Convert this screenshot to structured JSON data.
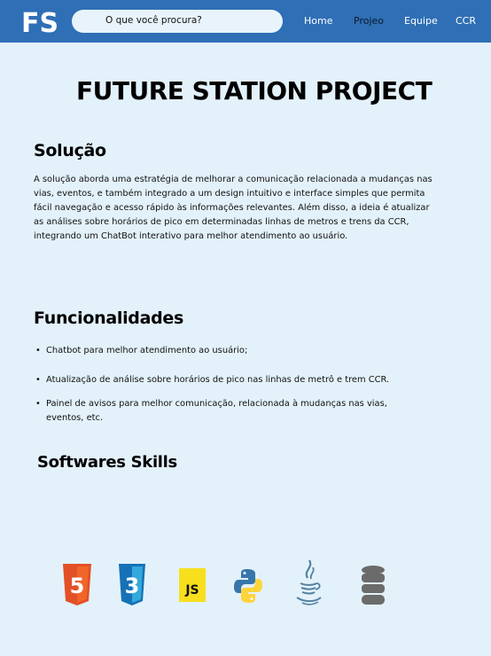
{
  "header": {
    "logo_text": "FS",
    "search_placeholder": "O que você procura?",
    "nav": [
      {
        "label": "Home",
        "active": false
      },
      {
        "label": "Projeo",
        "active": true
      },
      {
        "label": "Equipe",
        "active": false
      },
      {
        "label": "CCR",
        "active": false
      }
    ]
  },
  "page_title": "FUTURE STATION PROJECT",
  "solucao": {
    "heading": "Solução",
    "text": "A solução aborda uma estratégia de melhorar a comunicação relacionada a mudanças nas vias, eventos, e também integrado a um design intuitivo e interface simples que permita fácil navegação e acesso rápido às informações relevantes. Além disso, a ideia é atualizar as análises sobre horários de pico em determinadas linhas de metros e trens da CCR, integrando um ChatBot interativo para melhor atendimento ao usuário."
  },
  "funcionalidades": {
    "heading": "Funcionalidades",
    "items": [
      "Chatbot para melhor atendimento ao usuário;",
      "Atualização de análise sobre horários de pico nas linhas de metrô e trem CCR.",
      "Painel de avisos para melhor comunicação, relacionada à mudanças nas vias, eventos, etc."
    ]
  },
  "skills": {
    "heading": "Softwares Skills",
    "icons": [
      {
        "name": "html5-icon",
        "label": "5",
        "color": "#e34f26"
      },
      {
        "name": "css3-icon",
        "label": "3",
        "color": "#1572b6"
      },
      {
        "name": "javascript-icon",
        "label": "JS",
        "color": "#f7df1e"
      },
      {
        "name": "python-icon",
        "label": "",
        "color": "#3776ab"
      },
      {
        "name": "java-icon",
        "label": "",
        "color": "#5382a1"
      },
      {
        "name": "database-icon",
        "label": "",
        "color": "#6b6b6b"
      }
    ]
  },
  "colors": {
    "navbar": "#2f6fb5",
    "background": "#e3f1fa",
    "search_bg": "#e8f3fb"
  }
}
